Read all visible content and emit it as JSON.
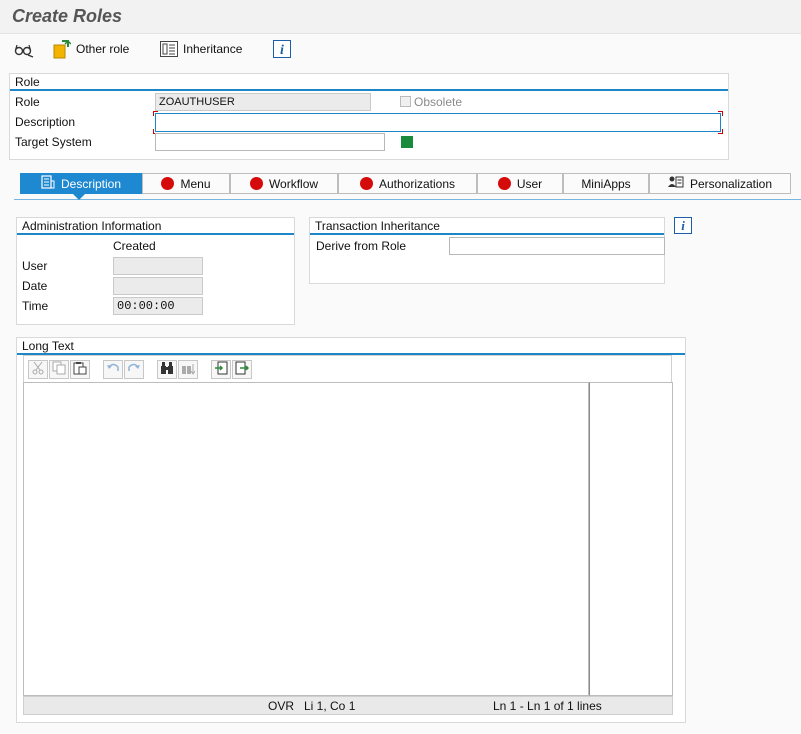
{
  "title": "Create Roles",
  "toolbar": {
    "other_role_label": "Other role",
    "inheritance_label": "Inheritance",
    "icons": [
      "glasses-icon",
      "other-role-icon",
      "inheritance-icon",
      "info-icon"
    ]
  },
  "role_group": {
    "header": "Role",
    "role_label": "Role",
    "role_value": "ZOAUTHUSER",
    "obsolete_label": "Obsolete",
    "description_label": "Description",
    "description_value": "",
    "target_system_label": "Target System",
    "target_system_value": ""
  },
  "tabs": [
    {
      "label": "Description",
      "icon": "description-icon",
      "active": true
    },
    {
      "label": "Menu",
      "icon": "red-status-icon",
      "active": false
    },
    {
      "label": "Workflow",
      "icon": "red-status-icon",
      "active": false
    },
    {
      "label": "Authorizations",
      "icon": "red-status-icon",
      "active": false
    },
    {
      "label": "User",
      "icon": "red-status-icon",
      "active": false
    },
    {
      "label": "MiniApps",
      "icon": "",
      "active": false
    },
    {
      "label": "Personalization",
      "icon": "personalization-icon",
      "active": false
    }
  ],
  "admin_info": {
    "header": "Administration Information",
    "created_label": "Created",
    "user_label": "User",
    "user_value": "",
    "date_label": "Date",
    "date_value": "",
    "time_label": "Time",
    "time_value": "00:00:00"
  },
  "transaction_inheritance": {
    "header": "Transaction Inheritance",
    "derive_label": "Derive from Role",
    "derive_value": ""
  },
  "long_text": {
    "header": "Long Text",
    "status_mode": "OVR",
    "status_cursor": "Li 1, Co 1",
    "status_lines": "Ln 1 - Ln 1 of 1 lines"
  },
  "colors": {
    "accent_blue": "#1e88d1",
    "status_red": "#d50b0b",
    "status_green": "#1a8a3c"
  }
}
